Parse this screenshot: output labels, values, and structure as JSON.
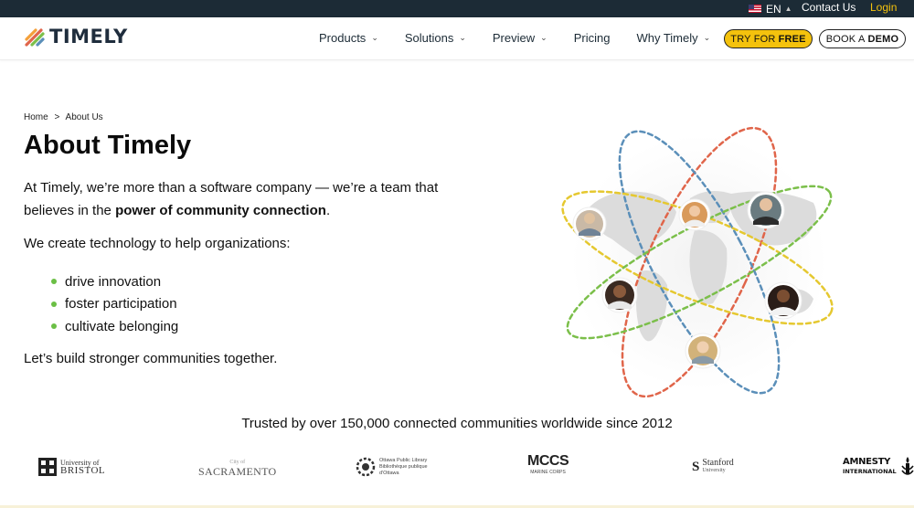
{
  "topbar": {
    "language": "EN",
    "contact_label": "Contact Us",
    "login_label": "Login"
  },
  "header": {
    "brand": "TIMELY",
    "nav": [
      {
        "label": "Products",
        "has_dropdown": true
      },
      {
        "label": "Solutions",
        "has_dropdown": true
      },
      {
        "label": "Preview",
        "has_dropdown": true
      },
      {
        "label": "Pricing",
        "has_dropdown": false
      },
      {
        "label": "Why Timely",
        "has_dropdown": true
      }
    ],
    "try_prefix": "TRY FOR",
    "try_strong": "FREE",
    "demo_prefix": "BOOK A",
    "demo_strong": "DEMO"
  },
  "breadcrumb": {
    "home": "Home",
    "separator": ">",
    "current": "About Us"
  },
  "content": {
    "title": "About Timely",
    "intro_start": "At Timely, we’re more than a software company — we’re a team that believes in the ",
    "intro_strong": "power of community connection",
    "intro_end": ".",
    "create_text": "We create technology to help organizations:",
    "bullets": [
      "drive innovation",
      "foster participation",
      "cultivate belonging"
    ],
    "closing": "Let’s build stronger communities together."
  },
  "trusted": {
    "text": "Trusted by over 150,000 connected communities worldwide since 2012",
    "logos": [
      {
        "line1": "University of",
        "line2": "BRISTOL"
      },
      {
        "line1": "City of",
        "line2": "SACRAMENTO"
      },
      {
        "line1": "Ottawa Public Library",
        "line2": "Bibliothèque publique d'Ottawa"
      },
      {
        "line1": "MCCS",
        "line2": "MARINE CORPS"
      },
      {
        "line1": "Stanford",
        "line2": "University"
      },
      {
        "line1": "AMNESTY",
        "line2": "INTERNATIONAL"
      }
    ]
  },
  "colors": {
    "topbar_bg": "#1c2b36",
    "accent_yellow": "#f4c20d",
    "bullet_green": "#6bbf45",
    "orbit_red": "#e0654a",
    "orbit_blue": "#5b8fb9",
    "orbit_yellow": "#e5c830",
    "orbit_green": "#7bbf4a"
  },
  "icons": {
    "flag": "us-flag-icon",
    "caret": "chevron-up-icon",
    "nav_chevron": "chevron-down-icon",
    "bullet": "green-dot-icon"
  }
}
